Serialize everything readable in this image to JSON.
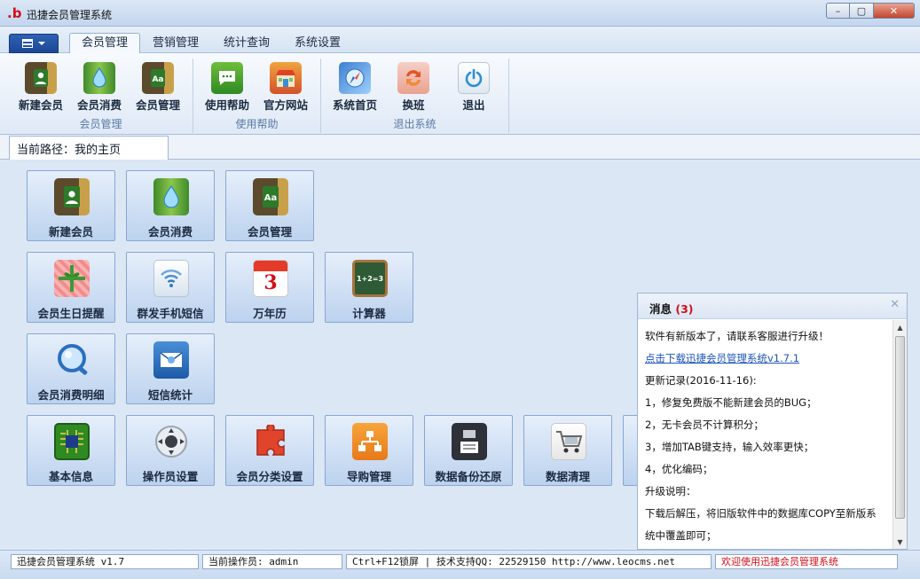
{
  "window": {
    "title": "迅捷会员管理系统",
    "logo_text": ".b",
    "buttons": {
      "min": "–",
      "max": "▢",
      "close": "✕"
    }
  },
  "menubar": {
    "tabs": [
      {
        "label": "会员管理",
        "active": true
      },
      {
        "label": "营销管理",
        "active": false
      },
      {
        "label": "统计查询",
        "active": false
      },
      {
        "label": "系统设置",
        "active": false
      }
    ]
  },
  "ribbon": {
    "groups": [
      {
        "label": "会员管理",
        "buttons": [
          {
            "label": "新建会员",
            "icon": "contact-book-icon"
          },
          {
            "label": "会员消费",
            "icon": "water-drop-icon"
          },
          {
            "label": "会员管理",
            "icon": "address-book-icon"
          }
        ]
      },
      {
        "label": "使用帮助",
        "buttons": [
          {
            "label": "使用帮助",
            "icon": "speech-bubble-icon"
          },
          {
            "label": "官方网站",
            "icon": "storefront-icon"
          }
        ]
      },
      {
        "label": "退出系统",
        "buttons": [
          {
            "label": "系统首页",
            "icon": "compass-icon"
          },
          {
            "label": "换班",
            "icon": "swap-arrows-icon"
          },
          {
            "label": "退出",
            "icon": "power-icon"
          }
        ]
      }
    ]
  },
  "path": {
    "text": "当前路径：我的主页"
  },
  "tiles": [
    {
      "label": "新建会员",
      "icon": "contact-book-icon"
    },
    {
      "label": "会员消费",
      "icon": "water-drop-icon"
    },
    {
      "label": "会员管理",
      "icon": "address-book-icon"
    },
    {
      "label": "会员生日提醒",
      "icon": "gift-icon"
    },
    {
      "label": "群发手机短信",
      "icon": "wifi-signal-icon"
    },
    {
      "label": "万年历",
      "icon": "calendar-icon",
      "glyph": "3"
    },
    {
      "label": "计算器",
      "icon": "chalkboard-icon",
      "glyph": "1+2=3"
    },
    {
      "label": "会员消费明细",
      "icon": "magnifier-icon"
    },
    {
      "label": "短信统计",
      "icon": "envelope-icon"
    },
    {
      "label": "基本信息",
      "icon": "circuit-board-icon"
    },
    {
      "label": "操作员设置",
      "icon": "joystick-icon"
    },
    {
      "label": "会员分类设置",
      "icon": "puzzle-icon"
    },
    {
      "label": "导购管理",
      "icon": "org-chart-icon"
    },
    {
      "label": "数据备份还原",
      "icon": "floppy-disk-icon"
    },
    {
      "label": "数据清理",
      "icon": "shopping-cart-icon"
    }
  ],
  "message": {
    "title": "消息",
    "count": "(3)",
    "lines": [
      "软件有新版本了，请联系客服进行升级！",
      "点击下载迅捷会员管理系统v1.7.1",
      "更新记录(2016-11-16):",
      "1，修复免费版不能新建会员的BUG；",
      "2，无卡会员不计算积分；",
      "3，增加TAB键支持，输入效率更快；",
      "4，优化编码；",
      "升级说明：",
      "下载后解压，将旧版软件中的数据库COPY至新版系统中覆盖即可；"
    ]
  },
  "status": {
    "version": "迅捷会员管理系统 v1.7",
    "operator": "当前操作员: admin",
    "support": "Ctrl+F12锁屏 | 技术支持QQ:  22529150     http://www.leocms.net",
    "welcome": "欢迎使用迅捷会员管理系统"
  },
  "colors": {
    "accent": "#2f62b3",
    "alert": "#d0101a",
    "link": "#1c55b8"
  }
}
